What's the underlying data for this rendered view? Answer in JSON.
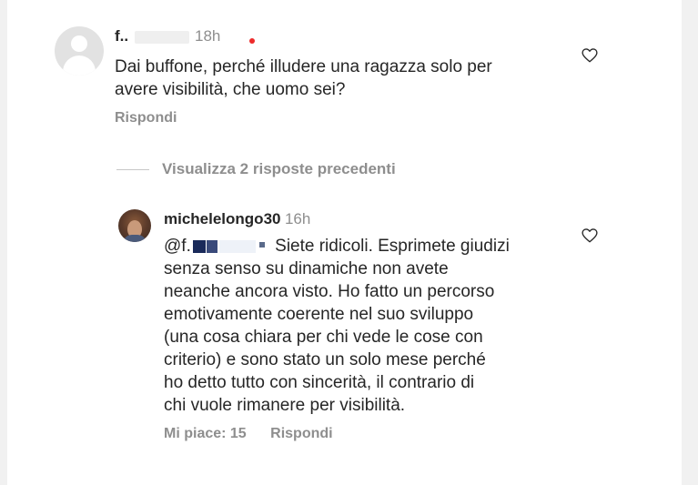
{
  "comments": [
    {
      "username": "f..",
      "time": "18h",
      "text_lines": [
        "Dai buffone, perché illudere una ragazza solo per",
        "avere visibilità, che uomo sei?"
      ],
      "reply_label": "Rispondi"
    },
    {
      "username": "michelelongo30",
      "time": "16h",
      "mention": "@f.",
      "text_lines": [
        "Siete ridicoli. Esprimete giudizi",
        "senza senso su dinamiche non avete",
        "neanche ancora visto. Ho fatto un percorso",
        "emotivamente coerente nel suo sviluppo",
        "(una cosa chiara per chi vede le cose con",
        "criterio) e sono stato un solo mese perché",
        "ho detto tutto con sincerità, il contrario di",
        "chi vuole rimanere per visibilità."
      ],
      "likes_label": "Mi piace: 15",
      "reply_label": "Rispondi"
    }
  ],
  "view_replies_label": "Visualizza 2 risposte precedenti",
  "colors": {
    "text": "#262626",
    "secondary": "#8e8e8e",
    "notification_dot": "#ed2b2b"
  },
  "icons": [
    "avatar",
    "heart-icon"
  ]
}
